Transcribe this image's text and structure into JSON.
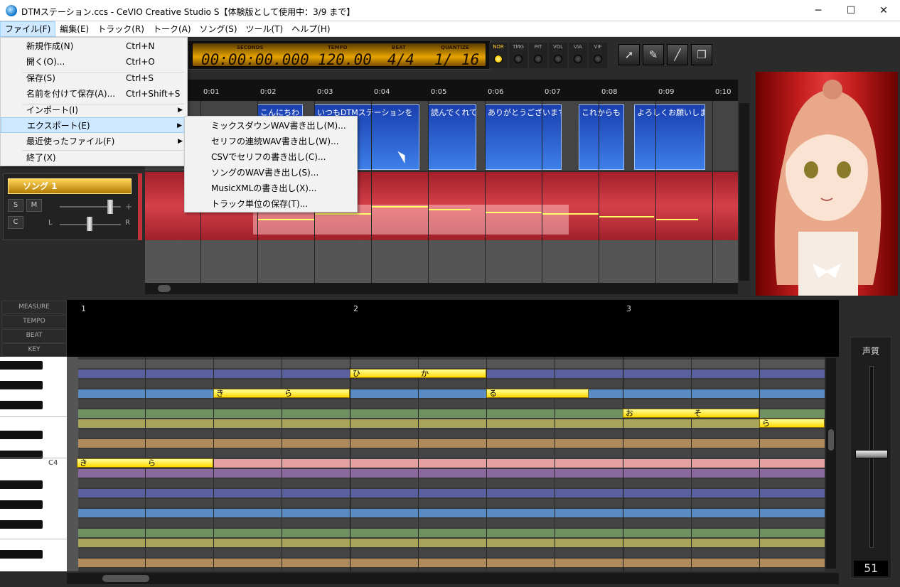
{
  "window": {
    "title": "DTMステーション.ccs - CeVIO Creative Studio S【体験版として使用中：3/9 まで】",
    "minimize": "─",
    "maximize": "☐",
    "close": "✕"
  },
  "menubar": [
    "ファイル(F)",
    "編集(E)",
    "トラック(R)",
    "トーク(A)",
    "ソング(S)",
    "ツール(T)",
    "ヘルプ(H)"
  ],
  "file_menu": [
    {
      "label": "新規作成(N)",
      "shortcut": "Ctrl+N"
    },
    {
      "label": "開く(O)...",
      "shortcut": "Ctrl+O"
    },
    {
      "label": "保存(S)",
      "shortcut": "Ctrl+S"
    },
    {
      "label": "名前を付けて保存(A)...",
      "shortcut": "Ctrl+Shift+S"
    },
    {
      "label": "インポート(I)",
      "shortcut": ""
    },
    {
      "label": "エクスポート(E)",
      "shortcut": ""
    },
    {
      "label": "最近使ったファイル(F)",
      "shortcut": ""
    },
    {
      "label": "終了(X)",
      "shortcut": ""
    }
  ],
  "export_submenu": [
    "ミックスダウンWAV書き出し(M)...",
    "セリフの連続WAV書き出し(W)...",
    "CSVでセリフの書き出し(C)...",
    "ソングのWAV書き出し(S)...",
    "MusicXMLの書き出し(X)...",
    "トラック単位の保存(T)..."
  ],
  "transport": {
    "seconds_label": "SECONDS",
    "seconds": "00:00:00.000",
    "tempo_label": "TEMPO",
    "tempo": "120.00",
    "beat_label": "BEAT",
    "beat": "4/4",
    "quantize_label": "QUANTIZE",
    "quantize": "1/ 16"
  },
  "modes": [
    "NOR",
    "TMG",
    "PIT",
    "VOL",
    "VIA",
    "VIF"
  ],
  "ruler": [
    "0:01",
    "0:02",
    "0:03",
    "0:04",
    "0:05",
    "0:06",
    "0:07",
    "0:08",
    "0:09",
    "0:10"
  ],
  "talk_clips": [
    "こんにちわ",
    "いつもDTMステーションを",
    "読んでくれて",
    "ありがとうございます",
    "これからも",
    "よろしくお願いします"
  ],
  "song_track": {
    "name": "ソング 1",
    "solo": "S",
    "mute": "M",
    "c": "C",
    "left": "L",
    "right": "R"
  },
  "pianoroll_headers": [
    "MEASURE",
    "TEMPO",
    "BEAT",
    "KEY"
  ],
  "measures": [
    "1",
    "2",
    "3"
  ],
  "key_label": "C4",
  "notes": [
    {
      "chars": [
        "ひ",
        "か"
      ]
    },
    {
      "chars": [
        "き",
        "ら"
      ]
    },
    {
      "chars": [
        "る"
      ]
    },
    {
      "chars": [
        "お",
        "そ"
      ]
    },
    {
      "chars": [
        "ら"
      ]
    },
    {
      "chars": [
        "き",
        "ら"
      ]
    }
  ],
  "voice_panel": {
    "title": "声質",
    "value": "51"
  },
  "colors": {
    "lcd": "#e7a400",
    "clip": "#2f66d8",
    "song_track": "#c4303a",
    "note": "#ffee44"
  }
}
